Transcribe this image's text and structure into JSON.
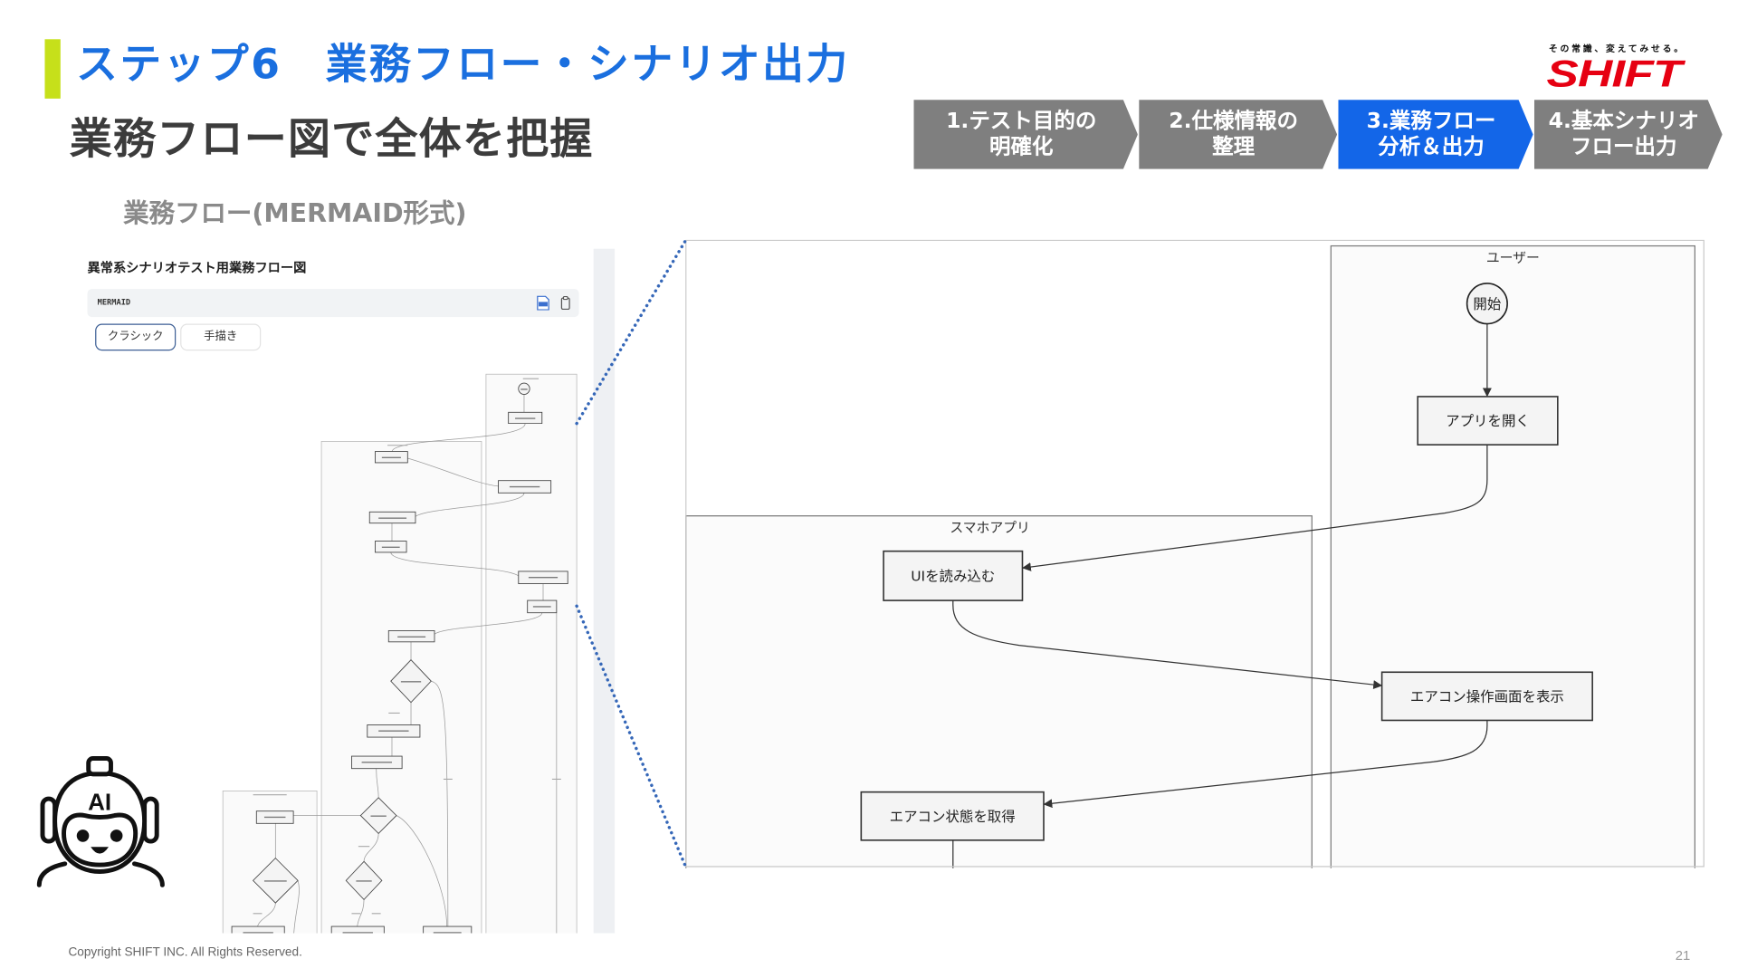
{
  "header": {
    "title": "ステップ6　業務フロー・シナリオ出力",
    "subtitle": "業務フロー図で全体を把握",
    "section_label": "業務フロー(MERMAID形式)"
  },
  "logo": {
    "tagline": "その常識、変えてみせる。",
    "name": "SHIFT"
  },
  "steps": [
    {
      "line1": "1.テスト目的の",
      "line2": "明確化",
      "active": false
    },
    {
      "line1": "2.仕様情報の",
      "line2": "整理",
      "active": false
    },
    {
      "line1": "3.業務フロー",
      "line2": "分析＆出力",
      "active": true
    },
    {
      "line1": "4.基本シナリオ",
      "line2": "フロー出力",
      "active": false
    }
  ],
  "preview": {
    "title": "異常系シナリオテスト用業務フロー図",
    "code_label": "MERMAID",
    "modes": [
      {
        "label": "クラシック",
        "selected": true
      },
      {
        "label": "手描き",
        "selected": false
      }
    ]
  },
  "zoom": {
    "lanes": {
      "user": "ユーザー",
      "app": "スマホアプリ"
    },
    "nodes": {
      "start": "開始",
      "open_app": "アプリを開く",
      "load_ui": "UIを読み込む",
      "show_screen": "エアコン操作画面を表示",
      "get_status": "エアコン状態を取得"
    }
  },
  "badge": {
    "text": "AI"
  },
  "footer": {
    "copyright": "Copyright SHIFT INC. All Rights Reserved.",
    "page": "21"
  },
  "icons": {
    "download": "svg-file-icon",
    "copy": "copy-icon",
    "badge": "ai-robot-icon"
  },
  "colors": {
    "title_blue": "#1a6fdf",
    "accent_bar": "#c6e01a",
    "step_active": "#1366e8",
    "step_inactive": "#7f7f7f",
    "brand_red": "#e60012",
    "connector": "#3567b8"
  }
}
